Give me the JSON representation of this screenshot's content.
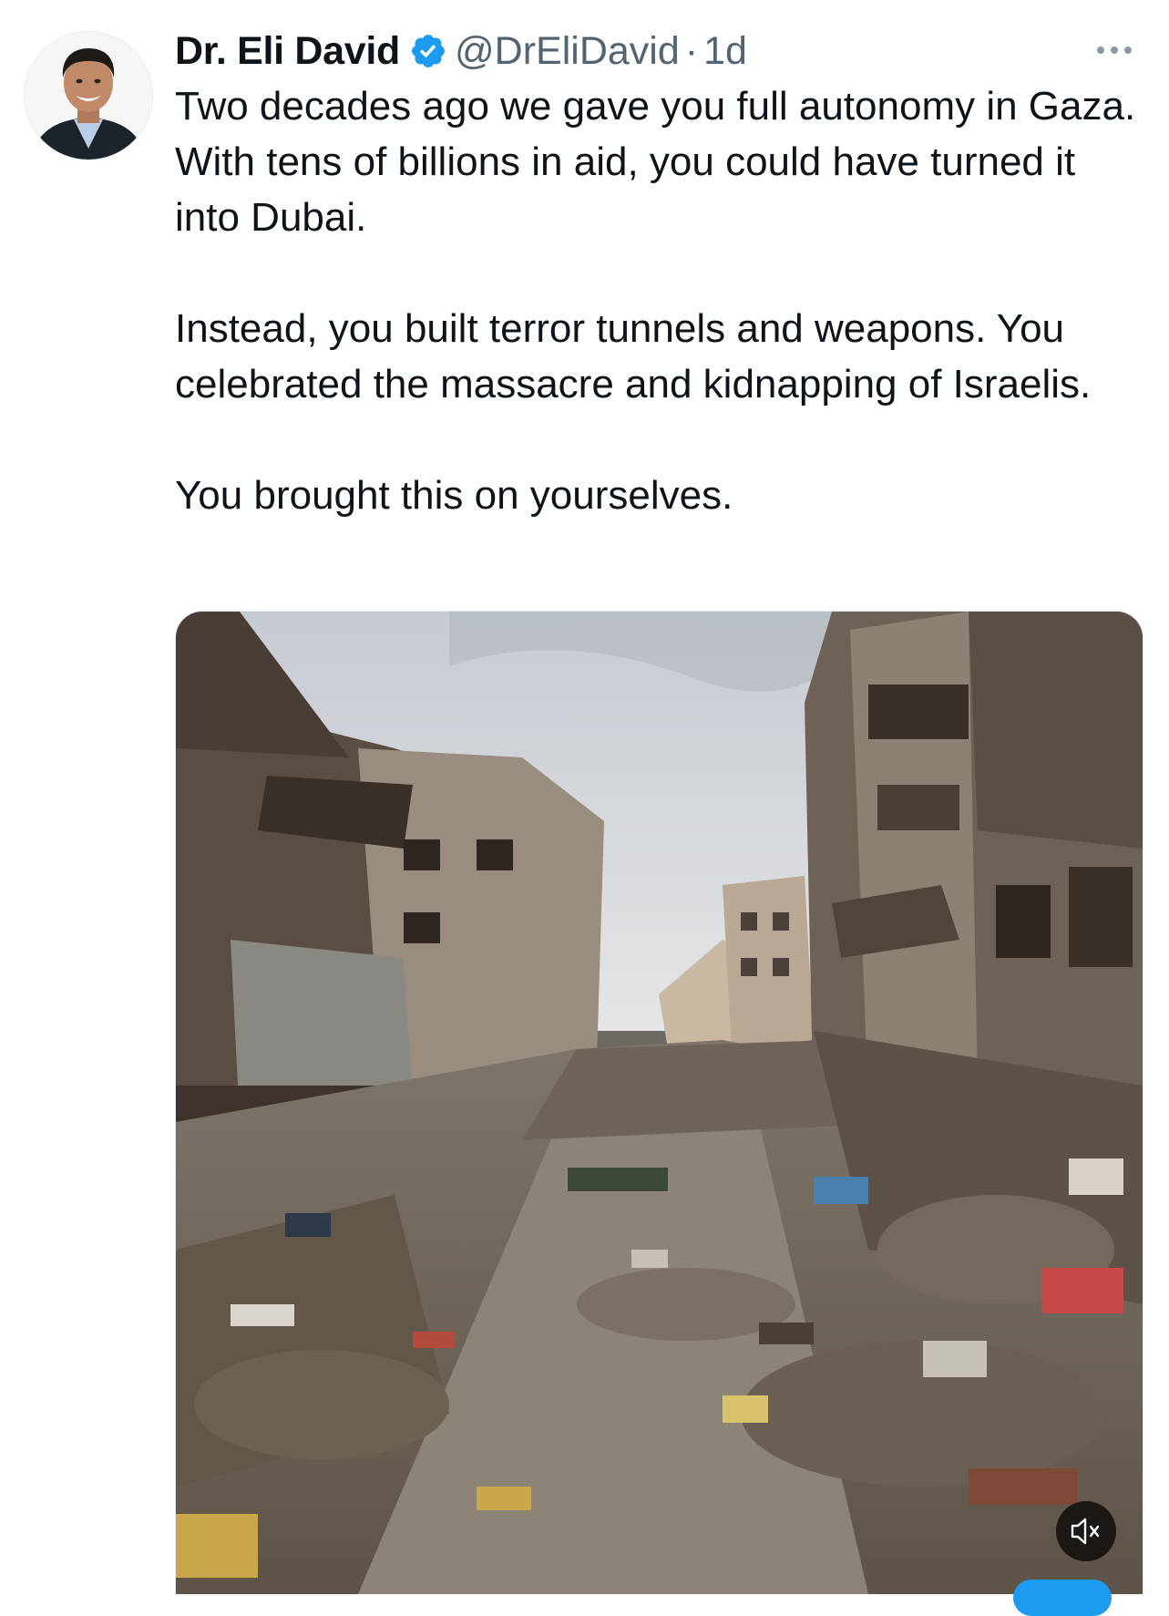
{
  "tweet": {
    "author": {
      "display_name": "Dr. Eli David",
      "handle": "@DrEliDavid",
      "verified_icon": "verified-badge-icon"
    },
    "separator": "·",
    "timestamp": "1d",
    "more_icon": "more-options-icon",
    "text": {
      "paragraph_1": "Two decades ago we gave you full autonomy in Gaza. With tens of billions in aid, you could have turned it into Dubai.",
      "paragraph_2": "Instead, you built terror tunnels and weapons. You celebrated the massacre and kidnapping of Israelis.",
      "paragraph_3": "You brought this on yourselves."
    },
    "media": {
      "type": "video",
      "mute_icon": "muted-speaker-icon"
    }
  },
  "colors": {
    "text_primary": "#0f1419",
    "text_secondary": "#536471",
    "verified_blue": "#1d9bf0",
    "border": "#e1e8ed"
  }
}
